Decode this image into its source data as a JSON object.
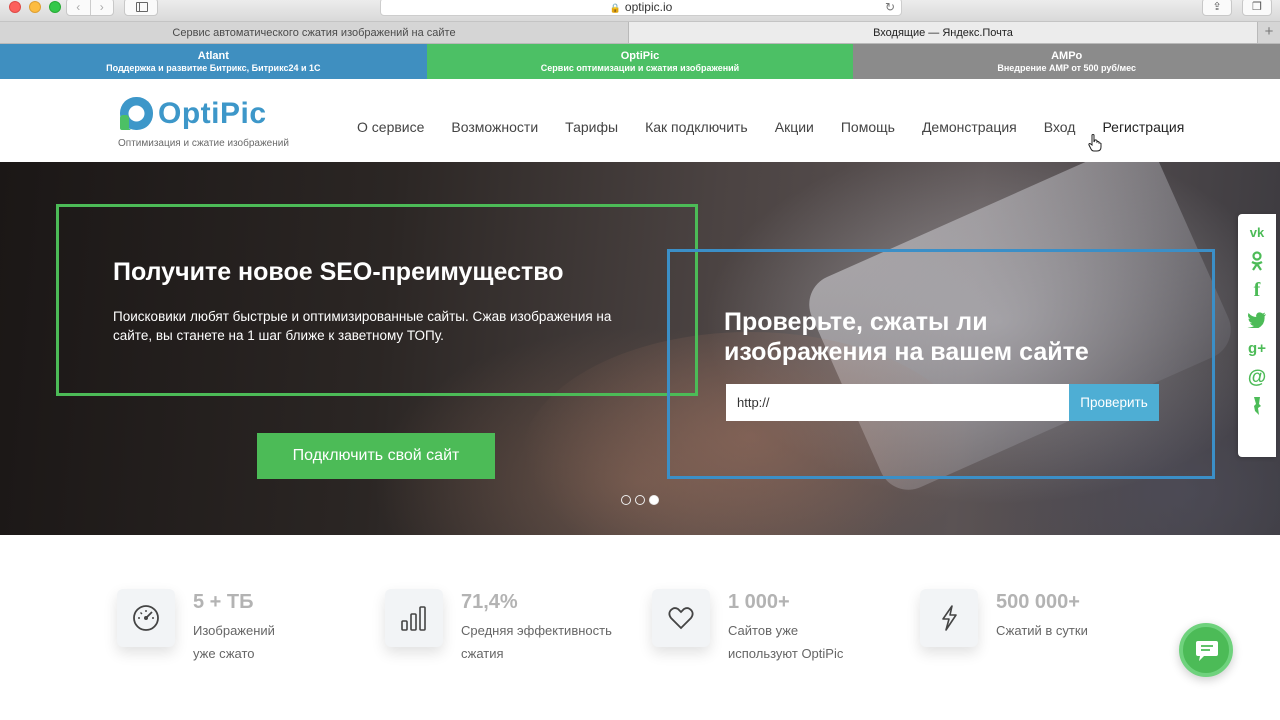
{
  "browser": {
    "address": "optipic.io",
    "tabs": [
      {
        "title": "Сервис автоматического сжатия изображений на сайте"
      },
      {
        "title": "Входящие — Яндекс.Почта"
      }
    ]
  },
  "promo": [
    {
      "title": "Atlant",
      "subtitle": "Поддержка и развитие Битрикс, Битрикс24 и 1С"
    },
    {
      "title": "OptiPic",
      "subtitle": "Сервис оптимизации и сжатия изображений"
    },
    {
      "title": "AMPo",
      "subtitle": "Внедрение AMP от 500 руб/мес"
    }
  ],
  "header": {
    "logo_text": "OptiPic",
    "logo_subtitle": "Оптимизация и сжатие изображений",
    "nav": [
      "О сервисе",
      "Возможности",
      "Тарифы",
      "Как подключить",
      "Акции",
      "Помощь",
      "Демонстрация",
      "Вход",
      "Регистрация"
    ]
  },
  "hero": {
    "title": "Получите новое SEO-преимущество",
    "text": "Поисковики любят быстрые и оптимизированные сайты. Сжав изображения на сайте, вы станете на 1 шаг ближе к заветному ТОПу.",
    "cta": "Подключить свой сайт",
    "check_title": "Проверьте, сжаты ли изображения на вашем сайте",
    "input_value": "http://",
    "check_button": "Проверить",
    "slides_total": 3,
    "active_slide": 3
  },
  "social": [
    "vk-icon",
    "odnoklassniki-icon",
    "facebook-icon",
    "twitter-icon",
    "google-plus-icon",
    "mail-icon",
    "bookmark-icon"
  ],
  "stats": [
    {
      "value": "5 + ТБ",
      "label": "Изображений уже сжато",
      "icon": "speedometer-icon"
    },
    {
      "value": "71,4%",
      "label": "Средняя эффективность сжатия",
      "icon": "bar-chart-icon"
    },
    {
      "value": "1 000+",
      "label": "Сайтов уже используют OptiPic",
      "icon": "heart-icon"
    },
    {
      "value": "500 000+",
      "label": "Сжатий в сутки",
      "icon": "lightning-icon"
    }
  ],
  "colors": {
    "green": "#4cbb57",
    "blue": "#3b8fc7",
    "gray": "#8b8b8b"
  }
}
